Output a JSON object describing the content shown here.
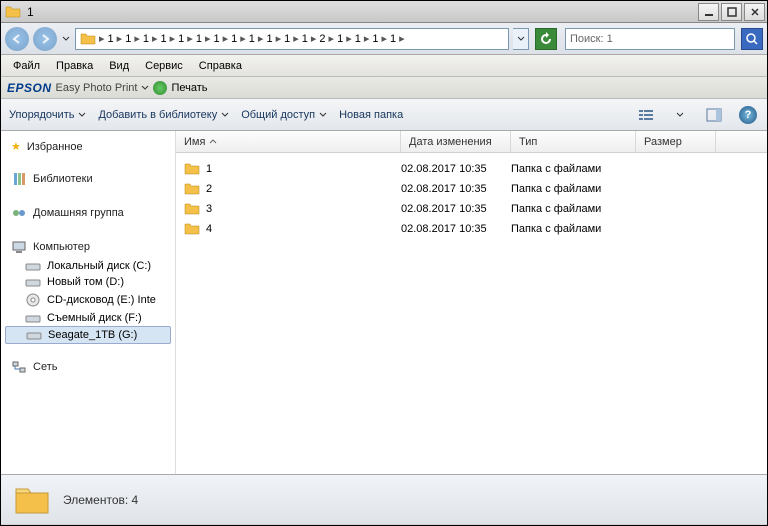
{
  "window": {
    "title": "1"
  },
  "breadcrumbs": [
    "1",
    "1",
    "1",
    "1",
    "1",
    "1",
    "1",
    "1",
    "1",
    "1",
    "1",
    "1",
    "2",
    "1",
    "1",
    "1",
    "1"
  ],
  "search": {
    "placeholder": "Поиск: 1"
  },
  "menu": [
    "Файл",
    "Правка",
    "Вид",
    "Сервис",
    "Справка"
  ],
  "epson": {
    "brand": "EPSON",
    "sub": "Easy Photo Print",
    "print": "Печать"
  },
  "toolbar": {
    "organize": "Упорядочить",
    "include": "Добавить в библиотеку",
    "share": "Общий доступ",
    "newfolder": "Новая папка"
  },
  "sidebar": {
    "favorites": "Избранное",
    "libraries": "Библиотеки",
    "homegroup": "Домашняя группа",
    "computer": "Компьютер",
    "drives": [
      "Локальный диск (C:)",
      "Новый том (D:)",
      "CD-дисковод (E:) Inte",
      "Съемный диск (F:)",
      "Seagate_1TB (G:)"
    ],
    "network": "Сеть"
  },
  "columns": {
    "name": "Имя",
    "date": "Дата изменения",
    "type": "Тип",
    "size": "Размер"
  },
  "files": [
    {
      "name": "1",
      "date": "02.08.2017 10:35",
      "type": "Папка с файлами",
      "size": ""
    },
    {
      "name": "2",
      "date": "02.08.2017 10:35",
      "type": "Папка с файлами",
      "size": ""
    },
    {
      "name": "3",
      "date": "02.08.2017 10:35",
      "type": "Папка с файлами",
      "size": ""
    },
    {
      "name": "4",
      "date": "02.08.2017 10:35",
      "type": "Папка с файлами",
      "size": ""
    }
  ],
  "status": {
    "text": "Элементов: 4"
  }
}
